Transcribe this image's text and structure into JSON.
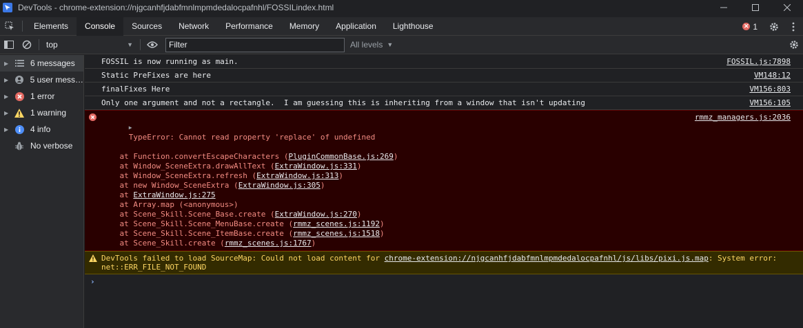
{
  "window": {
    "title": "DevTools - chrome-extension://njgcanhfjdabfmnlmpmdedalocpafnhl/FOSSILindex.html",
    "controls": [
      "minimize",
      "maximize",
      "close"
    ]
  },
  "tabs": [
    {
      "label": "Elements"
    },
    {
      "label": "Console"
    },
    {
      "label": "Sources"
    },
    {
      "label": "Network"
    },
    {
      "label": "Performance"
    },
    {
      "label": "Memory"
    },
    {
      "label": "Application"
    },
    {
      "label": "Lighthouse"
    }
  ],
  "active_tab": "Console",
  "error_count": "1",
  "toolbar": {
    "context": "top",
    "filter_placeholder": "Filter",
    "levels": "All levels"
  },
  "sidebar": {
    "items": [
      {
        "label": "6 messages",
        "icon": "list-icon",
        "selected": true
      },
      {
        "label": "5 user mess…",
        "icon": "user-icon"
      },
      {
        "label": "1 error",
        "icon": "error-icon"
      },
      {
        "label": "1 warning",
        "icon": "warning-icon"
      },
      {
        "label": "4 info",
        "icon": "info-icon"
      },
      {
        "label": "No verbose",
        "icon": "bug-icon"
      }
    ]
  },
  "messages": [
    {
      "text": "FOSSIL is now running as main.",
      "source": "FOSSIL.js:7898"
    },
    {
      "text": "Static PreFixes are here",
      "source": "VM148:12"
    },
    {
      "text": "finalFixes Here",
      "source": "VM156:803"
    },
    {
      "text": "Only one argument and not a rectangle.  I am guessing this is inheriting from a window that isn't updating",
      "source": "VM156:105"
    }
  ],
  "error": {
    "header": "TypeError: Cannot read property 'replace' of undefined",
    "source": "rmmz_managers.js:2036",
    "stack": [
      {
        "pre": "    at Function.convertEscapeCharacters (",
        "link": "PluginCommonBase.js:269",
        "post": ")"
      },
      {
        "pre": "    at Window_SceneExtra.drawAllText (",
        "link": "ExtraWindow.js:331",
        "post": ")"
      },
      {
        "pre": "    at Window_SceneExtra.refresh (",
        "link": "ExtraWindow.js:313",
        "post": ")"
      },
      {
        "pre": "    at new Window_SceneExtra (",
        "link": "ExtraWindow.js:305",
        "post": ")"
      },
      {
        "pre": "    at ",
        "link": "ExtraWindow.js:275",
        "post": ""
      },
      {
        "pre": "    at Array.map (<anonymous>)",
        "link": "",
        "post": ""
      },
      {
        "pre": "    at Scene_Skill.Scene_Base.create (",
        "link": "ExtraWindow.js:270",
        "post": ")"
      },
      {
        "pre": "    at Scene_Skill.Scene_MenuBase.create (",
        "link": "rmmz_scenes.js:1192",
        "post": ")"
      },
      {
        "pre": "    at Scene_Skill.Scene_ItemBase.create (",
        "link": "rmmz_scenes.js:1518",
        "post": ")"
      },
      {
        "pre": "    at Scene_Skill.create (",
        "link": "rmmz_scenes.js:1767",
        "post": ")"
      }
    ]
  },
  "warning": {
    "pre": "DevTools failed to load SourceMap: Could not load content for ",
    "link": "chrome-extension://njgcanhfjdabfmnlmpmdedalocpafnhl/js/libs/pixi.js.map",
    "post": ": System error: net::ERR_FILE_NOT_FOUND"
  },
  "prompt_symbol": "›",
  "colors": {
    "background": "#202124",
    "panel": "#292a2d",
    "error_bg": "#290000",
    "error_text": "#f28b82",
    "warning_bg": "#332b00",
    "warning_text": "#fdd663",
    "accent": "#8ab4f8"
  }
}
